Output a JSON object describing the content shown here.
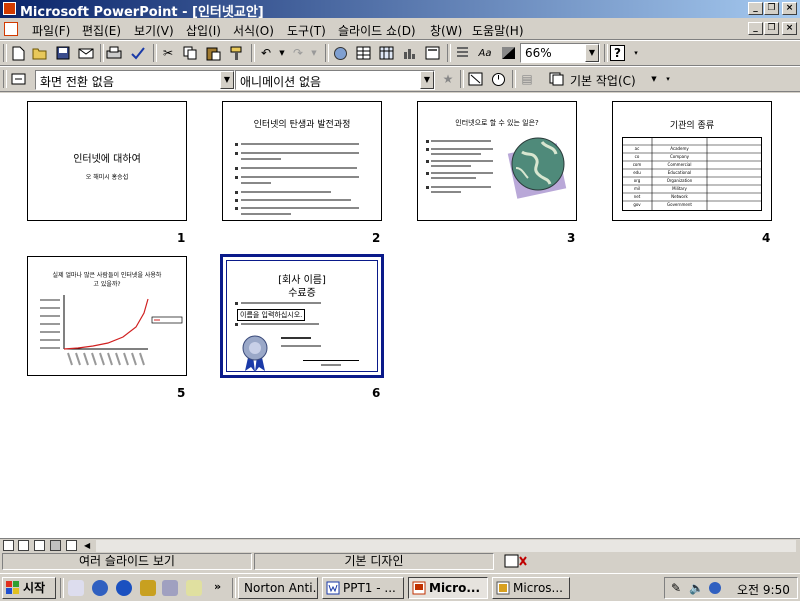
{
  "window": {
    "title": "Microsoft PowerPoint - [인터넷교안]"
  },
  "menu": [
    "파일(F)",
    "편집(E)",
    "보기(V)",
    "삽입(I)",
    "서식(O)",
    "도구(T)",
    "슬라이드 쇼(D)",
    "창(W)",
    "도움말(H)"
  ],
  "toolbar": {
    "zoom": "66%"
  },
  "toolbar2": {
    "transition": "화면 전환 없음",
    "animation": "애니메이션 없음",
    "task_label": "기본 작업(C)"
  },
  "slides": [
    {
      "num": "1",
      "title": "인터넷에 대하여",
      "subtitle": "오 해미시 홍승섭"
    },
    {
      "num": "2",
      "title": "인터넷의 탄생과 발전과정"
    },
    {
      "num": "3",
      "title": "인터넷으로 할 수 있는 일은?"
    },
    {
      "num": "4",
      "title": "기관의 종류",
      "rows": [
        [
          "ac",
          "Academy"
        ],
        [
          "co",
          "Company"
        ],
        [
          "com",
          "Commercial"
        ],
        [
          "edu",
          "Educational"
        ],
        [
          "org",
          "Organization"
        ],
        [
          "mil",
          "Military"
        ],
        [
          "net",
          "Network"
        ],
        [
          "gov",
          "Government"
        ]
      ]
    },
    {
      "num": "5",
      "title": "실제 얼마나 많은 사람들이 인터넷을 사용하고 있을까?"
    },
    {
      "num": "6",
      "title": "[회사 이름]",
      "subtitle": "수료증",
      "field": "이름을 입력하십시오."
    }
  ],
  "statusbar": {
    "view": "여러 슬라이드 보기",
    "design": "기본 디자인"
  },
  "taskbar": {
    "start": "시작",
    "buttons": [
      "Norton Anti...",
      "PPT1 - ...",
      "Micro...",
      "Micros..."
    ],
    "active_index": 2,
    "clock": "오전 9:50"
  }
}
